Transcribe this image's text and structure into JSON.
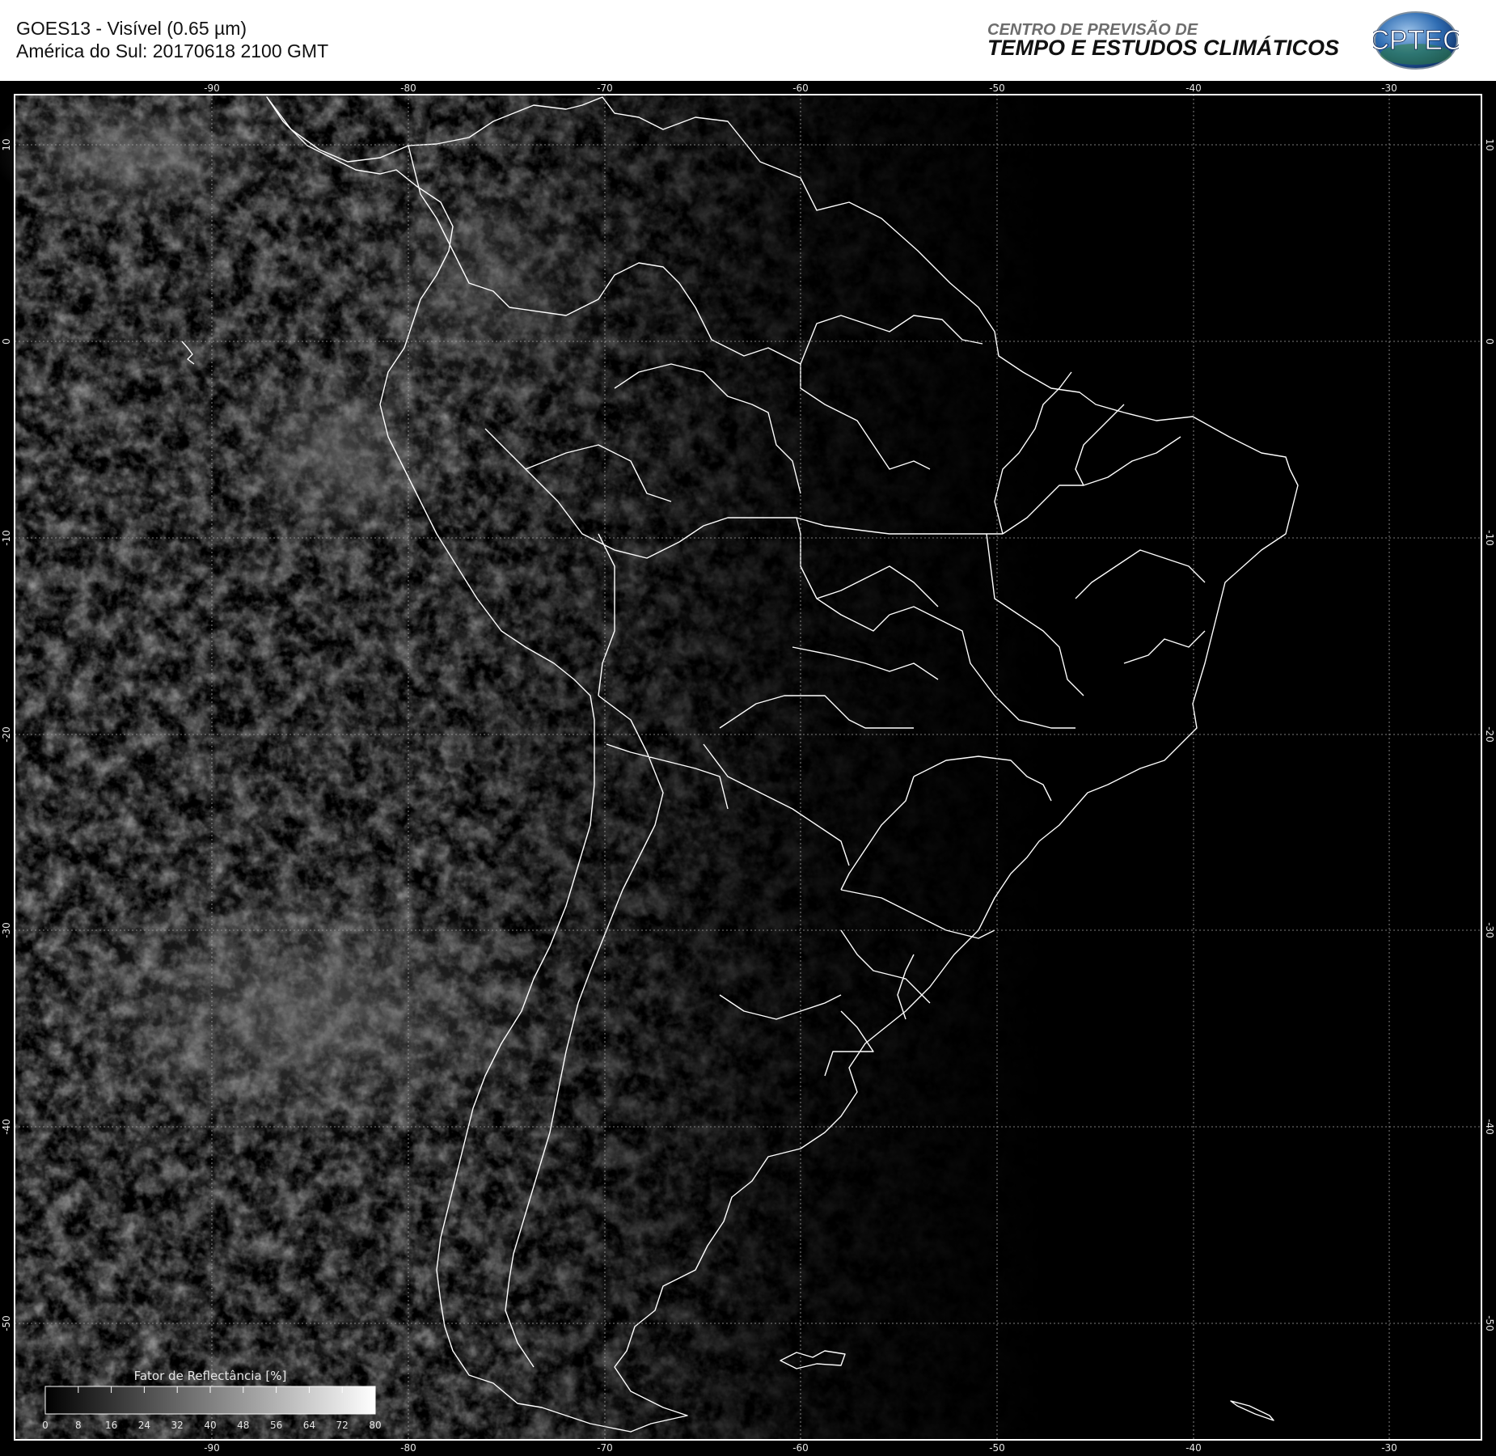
{
  "header": {
    "title_line1": "GOES13 - Visível (0.65 µm)",
    "title_line2": "América do Sul: 20170618 2100 GMT",
    "org_line1": "CENTRO DE PREVISÃO DE",
    "org_line2": "TEMPO E ESTUDOS CLIMÁTICOS",
    "logo_text": "CPTEC"
  },
  "map": {
    "longitude_labels": [
      "-90",
      "-80",
      "-70",
      "-60",
      "-50",
      "-40",
      "-30"
    ],
    "latitude_labels": [
      "10",
      "0",
      "-10",
      "-20",
      "-30",
      "-40",
      "-50"
    ],
    "background_color": "#000000",
    "coastline_color": "#ffffff",
    "grid_style": "dotted"
  },
  "colorbar": {
    "title": "Fator de Reflectância [%]",
    "ticks": [
      "0",
      "8",
      "16",
      "24",
      "32",
      "40",
      "48",
      "56",
      "64",
      "72",
      "80"
    ]
  }
}
